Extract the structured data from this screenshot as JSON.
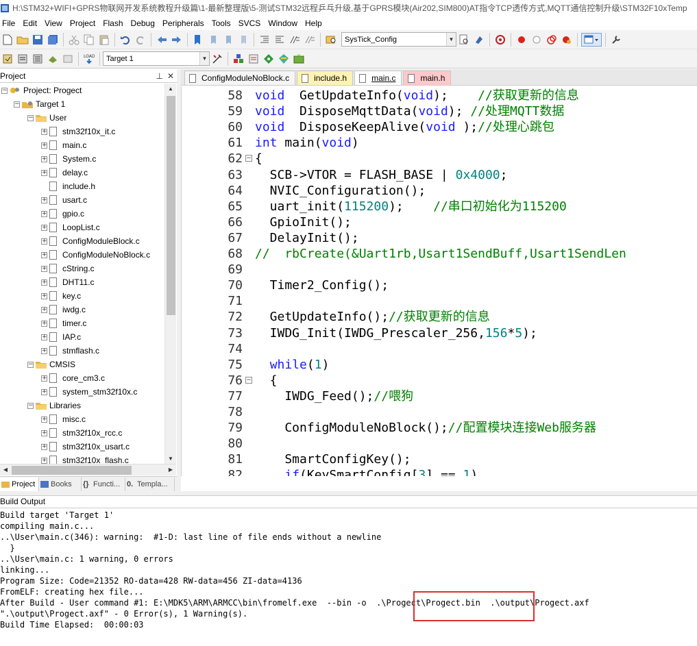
{
  "window": {
    "title": "H:\\STM32+WIFI+GPRS物联网开发系统教程升级篇\\1-最新整理版\\5-测试STM32远程乒乓升级,基于GPRS模块(Air202,SIM800)AT指令TCP透传方式,MQTT通信控制升级\\STM32F10xTemp"
  },
  "menu": [
    "File",
    "Edit",
    "View",
    "Project",
    "Flash",
    "Debug",
    "Peripherals",
    "Tools",
    "SVCS",
    "Window",
    "Help"
  ],
  "toolbar": {
    "function_combo": "SysTick_Config",
    "target_combo": "Target 1"
  },
  "project_panel": {
    "title": "Project",
    "root": "Project: Progect",
    "target": "Target 1",
    "groups": [
      {
        "name": "User",
        "files": [
          "stm32f10x_it.c",
          "main.c",
          "System.c",
          "delay.c",
          "include.h",
          "usart.c",
          "gpio.c",
          "LoopList.c",
          "ConfigModuleBlock.c",
          "ConfigModuleNoBlock.c",
          "cString.c",
          "DHT11.c",
          "key.c",
          "iwdg.c",
          "timer.c",
          "IAP.c",
          "stmflash.c"
        ]
      },
      {
        "name": "CMSIS",
        "files": [
          "core_cm3.c",
          "system_stm32f10x.c"
        ]
      },
      {
        "name": "Libraries",
        "files": [
          "misc.c",
          "stm32f10x_rcc.c",
          "stm32f10x_usart.c",
          "stm32f10x_flash.c"
        ]
      }
    ],
    "tabs": [
      "Project",
      "Books",
      "Functi...",
      "Templa..."
    ]
  },
  "editor": {
    "tabs": [
      {
        "label": "ConfigModuleNoBlock.c",
        "color": "#f5f5f5"
      },
      {
        "label": "include.h",
        "color": "#fff3b3"
      },
      {
        "label": "main.c",
        "color": "#ffffff",
        "active": true
      },
      {
        "label": "main.h",
        "color": "#ffc8cc"
      }
    ],
    "lines": [
      {
        "n": "58",
        "fold": "",
        "code": [
          [
            "kw",
            "void"
          ],
          [
            "",
            "  GetUpdateInfo("
          ],
          [
            "kw",
            "void"
          ],
          [
            "",
            ");    "
          ],
          [
            "cm",
            "//获取更新的信息"
          ]
        ]
      },
      {
        "n": "59",
        "fold": "",
        "code": [
          [
            "kw",
            "void"
          ],
          [
            "",
            "  DisposeMqttData("
          ],
          [
            "kw",
            "void"
          ],
          [
            "",
            "); "
          ],
          [
            "cm",
            "//处理MQTT数据"
          ]
        ]
      },
      {
        "n": "60",
        "fold": "",
        "code": [
          [
            "kw",
            "void"
          ],
          [
            "",
            "  DisposeKeepAlive("
          ],
          [
            "kw",
            "void"
          ],
          [
            "",
            " );"
          ],
          [
            "cm",
            "//处理心跳包"
          ]
        ]
      },
      {
        "n": "61",
        "fold": "",
        "code": [
          [
            "kw",
            "int"
          ],
          [
            "",
            " main("
          ],
          [
            "kw",
            "void"
          ],
          [
            "",
            ")"
          ]
        ]
      },
      {
        "n": "62",
        "fold": "⊟",
        "code": [
          [
            "",
            "{"
          ]
        ]
      },
      {
        "n": "63",
        "fold": "",
        "code": [
          [
            "",
            "  SCB->VTOR = FLASH_BASE | "
          ],
          [
            "num",
            "0x4000"
          ],
          [
            "",
            ";"
          ]
        ]
      },
      {
        "n": "64",
        "fold": "",
        "code": [
          [
            "",
            "  NVIC_Configuration();"
          ]
        ]
      },
      {
        "n": "65",
        "fold": "",
        "code": [
          [
            "",
            "  uart_init("
          ],
          [
            "num",
            "115200"
          ],
          [
            "",
            ");    "
          ],
          [
            "cm",
            "//串口初始化为115200"
          ]
        ]
      },
      {
        "n": "66",
        "fold": "",
        "code": [
          [
            "",
            "  GpioInit();"
          ]
        ]
      },
      {
        "n": "67",
        "fold": "",
        "code": [
          [
            "",
            "  DelayInit();"
          ]
        ]
      },
      {
        "n": "68",
        "fold": "",
        "code": [
          [
            "cm",
            "//  rbCreate(&Uart1rb,Usart1SendBuff,Usart1SendLen"
          ]
        ]
      },
      {
        "n": "69",
        "fold": "",
        "code": [
          [
            "",
            ""
          ]
        ]
      },
      {
        "n": "70",
        "fold": "",
        "code": [
          [
            "",
            "  Timer2_Config();"
          ]
        ]
      },
      {
        "n": "71",
        "fold": "",
        "code": [
          [
            "",
            ""
          ]
        ]
      },
      {
        "n": "72",
        "fold": "",
        "code": [
          [
            "",
            "  GetUpdateInfo();"
          ],
          [
            "cm",
            "//获取更新的信息"
          ]
        ]
      },
      {
        "n": "73",
        "fold": "",
        "code": [
          [
            "",
            "  IWDG_Init(IWDG_Prescaler_256,"
          ],
          [
            "num",
            "156"
          ],
          [
            "",
            "*"
          ],
          [
            "num",
            "5"
          ],
          [
            "",
            ");"
          ]
        ]
      },
      {
        "n": "74",
        "fold": "",
        "code": [
          [
            "",
            ""
          ]
        ]
      },
      {
        "n": "75",
        "fold": "",
        "code": [
          [
            "",
            "  "
          ],
          [
            "kw",
            "while"
          ],
          [
            "",
            "("
          ],
          [
            "num",
            "1"
          ],
          [
            "",
            ")"
          ]
        ]
      },
      {
        "n": "76",
        "fold": "⊟",
        "code": [
          [
            "",
            "  {"
          ]
        ]
      },
      {
        "n": "77",
        "fold": "",
        "code": [
          [
            "",
            "    IWDG_Feed();"
          ],
          [
            "cm",
            "//喂狗"
          ]
        ]
      },
      {
        "n": "78",
        "fold": "",
        "code": [
          [
            "",
            ""
          ]
        ]
      },
      {
        "n": "79",
        "fold": "",
        "code": [
          [
            "",
            "    ConfigModuleNoBlock();"
          ],
          [
            "cm",
            "//配置模块连接Web服务器"
          ]
        ]
      },
      {
        "n": "80",
        "fold": "",
        "code": [
          [
            "",
            ""
          ]
        ]
      },
      {
        "n": "81",
        "fold": "",
        "code": [
          [
            "",
            "    SmartConfigKey();"
          ]
        ]
      },
      {
        "n": "82",
        "fold": "",
        "code": [
          [
            "",
            "    "
          ],
          [
            "kw",
            "if"
          ],
          [
            "",
            "(KeySmartConfig["
          ],
          [
            "num",
            "3"
          ],
          [
            "",
            "] == "
          ],
          [
            "num",
            "1"
          ],
          [
            "",
            ")"
          ]
        ]
      }
    ]
  },
  "build_output": {
    "title": "Build Output",
    "lines": [
      "Build target 'Target 1'",
      "compiling main.c...",
      "..\\User\\main.c(346): warning:  #1-D: last line of file ends without a newline",
      "  }",
      "..\\User\\main.c: 1 warning, 0 errors",
      "linking...",
      "Program Size: Code=21352 RO-data=428 RW-data=456 ZI-data=4136",
      "FromELF: creating hex file...",
      "After Build - User command #1: E:\\MDK5\\ARM\\ARMCC\\bin\\fromelf.exe  --bin -o  .\\Progect\\Progect.bin  .\\output\\Progect.axf",
      "\".\\output\\Progect.axf\" - 0 Error(s), 1 Warning(s).",
      "Build Time Elapsed:  00:00:03"
    ]
  }
}
